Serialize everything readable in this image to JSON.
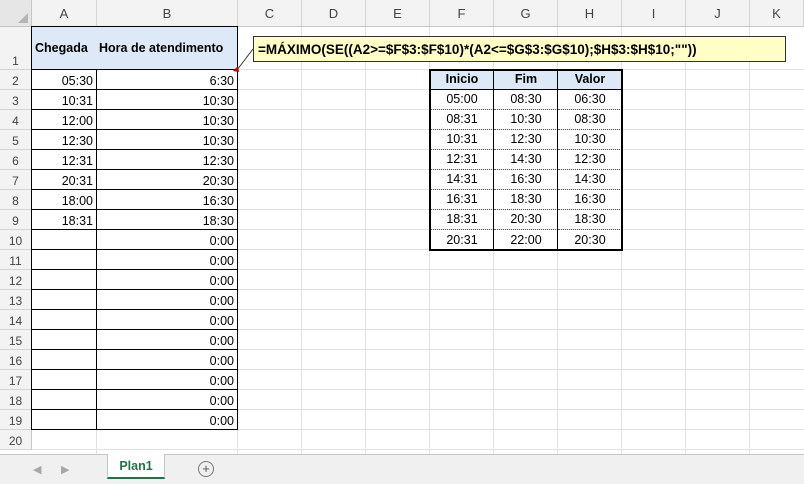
{
  "columns": [
    "A",
    "B",
    "C",
    "D",
    "E",
    "F",
    "G",
    "H",
    "I",
    "J",
    "K"
  ],
  "rows": [
    "1",
    "2",
    "3",
    "4",
    "5",
    "6",
    "7",
    "8",
    "9",
    "10",
    "11",
    "12",
    "13",
    "14",
    "15",
    "16",
    "17",
    "18",
    "19",
    "20"
  ],
  "headers": {
    "a1": "Chegada",
    "b1": "Hora de atendimento"
  },
  "arrivals": [
    "05:30",
    "10:31",
    "12:00",
    "12:30",
    "12:31",
    "20:31",
    "18:00",
    "18:31"
  ],
  "service_times": [
    "6:30",
    "10:30",
    "10:30",
    "10:30",
    "12:30",
    "20:30",
    "16:30",
    "18:30",
    "0:00",
    "0:00",
    "0:00",
    "0:00",
    "0:00",
    "0:00",
    "0:00",
    "0:00",
    "0:00",
    "0:00"
  ],
  "formula": "=MÁXIMO(SE((A2>=$F$3:$F$10)*(A2<=$G$3:$G$10);$H$3:$H$10;\"\"))",
  "lookup": {
    "headers": [
      "Inicio",
      "Fim",
      "Valor"
    ],
    "rows": [
      [
        "05:00",
        "08:30",
        "06:30"
      ],
      [
        "08:31",
        "10:30",
        "08:30"
      ],
      [
        "10:31",
        "12:30",
        "10:30"
      ],
      [
        "12:31",
        "14:30",
        "12:30"
      ],
      [
        "14:31",
        "16:30",
        "14:30"
      ],
      [
        "16:31",
        "18:30",
        "16:30"
      ],
      [
        "18:31",
        "20:30",
        "18:30"
      ],
      [
        "20:31",
        "22:00",
        "20:30"
      ]
    ]
  },
  "sheet_tab": "Plan1",
  "colors": {
    "header_fill": "#dde9f6",
    "formula_fill": "#ffffc6",
    "tab_accent": "#217346"
  }
}
